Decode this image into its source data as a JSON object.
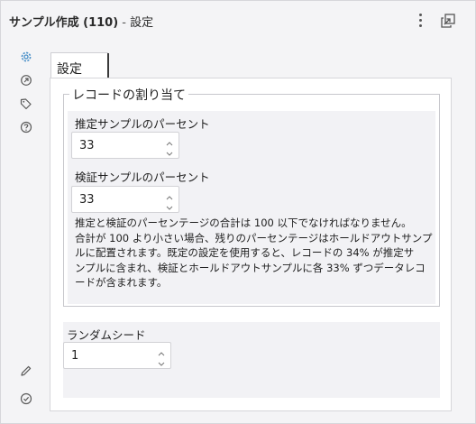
{
  "window": {
    "title_bold": "サンプル作成 (110)",
    "title_sep": " - ",
    "title_suffix": "設定"
  },
  "sidebar": {
    "items": [
      {
        "name": "settings-icon",
        "active": true
      },
      {
        "name": "connection-icon",
        "active": false
      },
      {
        "name": "tag-icon",
        "active": false
      },
      {
        "name": "help-icon",
        "active": false
      }
    ],
    "bottom": [
      {
        "name": "pencil-icon"
      },
      {
        "name": "check-circle-icon"
      }
    ]
  },
  "tabs": [
    {
      "label": "設定",
      "active": true
    }
  ],
  "record_allocation": {
    "legend": "レコードの割り当て",
    "estimation": {
      "label": "推定サンプルのパーセント",
      "value": "33"
    },
    "validation": {
      "label": "検証サンプルのパーセント",
      "value": "33"
    },
    "info_lines": [
      "推定と検証のパーセンテージの合計は 100 以下でなければなりません。",
      "合計が 100 より小さい場合、残りのパーセンテージはホールドアウトサンプ",
      "ルに配置されます。既定の設定を使用すると、レコードの 34% が推定サ",
      "ンプルに含まれ、検証とホールドアウトサンプルに各 33% ずつデータレコ",
      "ードが含まれます。"
    ]
  },
  "random_seed": {
    "label": "ランダムシード",
    "value": "1"
  },
  "colors": {
    "accent": "#4a90c8",
    "icon": "#5a5a5a"
  }
}
